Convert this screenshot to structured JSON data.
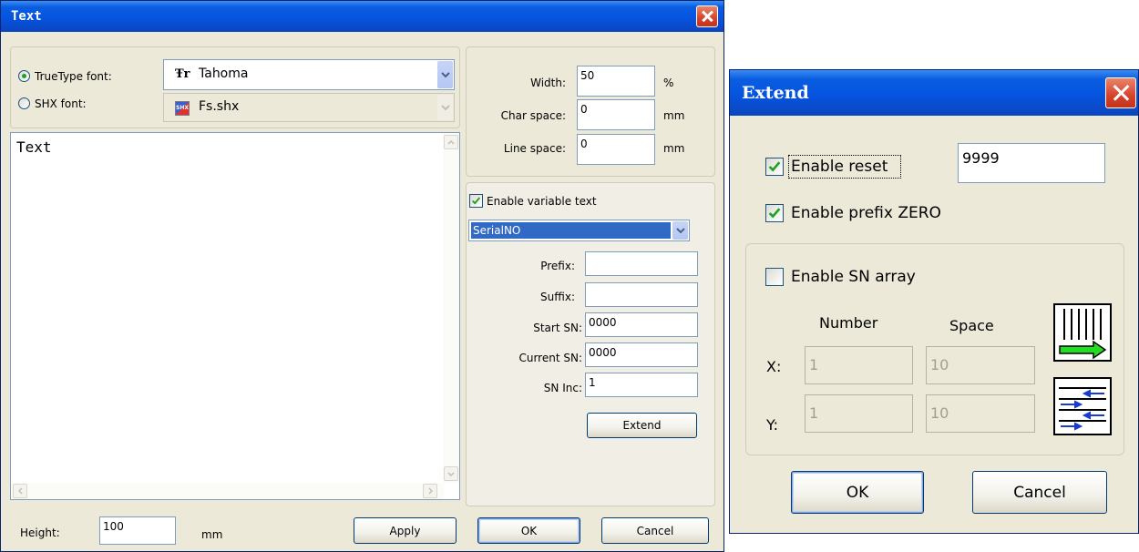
{
  "text_dialog": {
    "title": "Text",
    "truetype_label": "TrueType font:",
    "shx_label": "SHX font:",
    "truetype_font": "Tahoma",
    "shx_font": "Fs.shx",
    "truetype_icon": "Ŧr",
    "shx_icon": "SHX",
    "width_label": "Width:",
    "width_value": "50",
    "width_unit": "%",
    "char_space_label": "Char space:",
    "char_space_value": "0",
    "char_space_unit": "mm",
    "line_space_label": "Line space:",
    "line_space_value": "0",
    "line_space_unit": "mm",
    "text_content": "Text",
    "enable_variable_label": "Enable variable text",
    "variable_type": "SerialNO",
    "prefix_label": "Prefix:",
    "prefix_value": "",
    "suffix_label": "Suffix:",
    "suffix_value": "",
    "start_sn_label": "Start SN:",
    "start_sn_value": "0000",
    "current_sn_label": "Current SN:",
    "current_sn_value": "0000",
    "sn_inc_label": "SN Inc:",
    "sn_inc_value": "1",
    "extend_button": "Extend",
    "height_label": "Height:",
    "height_value": "100",
    "height_unit": "mm",
    "apply_button": "Apply",
    "ok_button": "OK",
    "cancel_button": "Cancel"
  },
  "extend_dialog": {
    "title": "Extend",
    "enable_reset_label": "Enable reset",
    "reset_value": "9999",
    "enable_prefix_zero_label": "Enable prefix ZERO",
    "enable_sn_array_label": "Enable SN array",
    "number_header": "Number",
    "space_header": "Space",
    "x_label": "X:",
    "y_label": "Y:",
    "x_number": "1",
    "x_space": "10",
    "y_number": "1",
    "y_space": "10",
    "ok_button": "OK",
    "cancel_button": "Cancel"
  },
  "state": {
    "truetype_selected": true,
    "variable_text_enabled": true,
    "reset_enabled": true,
    "prefix_zero_enabled": true,
    "sn_array_enabled": false
  },
  "colors": {
    "title_bar": "#0554e0",
    "close_button": "#d8412a",
    "window_bg": "#ece9d8",
    "check_mark": "#21a121",
    "combo_selection": "#316ac5",
    "arrow_green": "#22dd22",
    "arrow_blue": "#1a3ccc"
  },
  "icons": {
    "truetype_font": "truetype-font-icon",
    "shx_font": "shx-font-icon",
    "combo_arrow": "chevron-down-icon",
    "horizontal_array": "horizontal-array-icon",
    "vertical_array": "vertical-array-icon"
  }
}
